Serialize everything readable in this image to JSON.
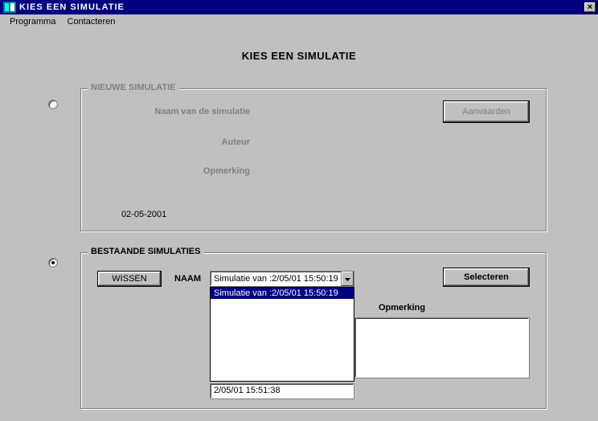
{
  "window": {
    "title": "KIES  EEN SIMULATIE",
    "close_symbol": "×"
  },
  "menu": {
    "program": "Programma",
    "contact": "Contacteren"
  },
  "page_heading": "KIES   EEN SIMULATIE",
  "new_sim": {
    "legend": "NIEUWE SIMULATIE",
    "label_name": "Naam van de simulatie",
    "label_author": "Auteur",
    "label_remark": "Opmerking",
    "date": "02-05-2001",
    "accept_btn": "Aanvaarden"
  },
  "existing": {
    "legend": "BESTAANDE SIMULATIES",
    "delete_btn": "WISSEN",
    "name_label": "NAAM",
    "select_btn": "Selecteren",
    "remark_label": "Opmerking",
    "dropdown_value": "Simulatie van :2/05/01 15:50:19",
    "dropdown_items": [
      "Simulatie van :2/05/01 15:50:19"
    ],
    "hidden_date_peek": "2/05/01 15:51:38"
  }
}
